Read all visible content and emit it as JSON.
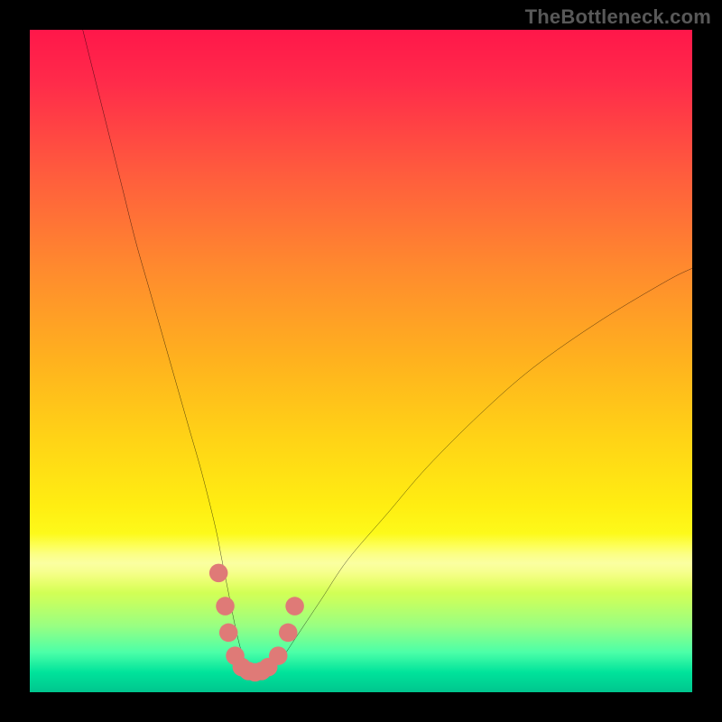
{
  "watermark": {
    "text": "TheBottleneck.com"
  },
  "chart_data": {
    "type": "line",
    "title": "",
    "xlabel": "",
    "ylabel": "",
    "xlim": [
      0,
      100
    ],
    "ylim": [
      0,
      100
    ],
    "grid": false,
    "legend": false,
    "series": [
      {
        "name": "bottleneck-curve",
        "color": "#000000",
        "x": [
          8,
          10,
          12,
          14,
          16,
          18,
          20,
          22,
          24,
          26,
          28,
          29,
          30,
          31,
          32,
          33,
          34,
          35,
          36,
          37,
          38,
          40,
          44,
          48,
          54,
          60,
          68,
          76,
          86,
          96,
          100
        ],
        "y": [
          100,
          92,
          84,
          76,
          68,
          61,
          54,
          47,
          40,
          33,
          25,
          20,
          15,
          10,
          6,
          4,
          3,
          3,
          3,
          4,
          5,
          8,
          14,
          20,
          27,
          34,
          42,
          49,
          56,
          62,
          64
        ]
      }
    ],
    "markers": {
      "name": "highlight-dots",
      "color": "#df7a77",
      "points": [
        {
          "x": 28.5,
          "y": 18
        },
        {
          "x": 29.5,
          "y": 13
        },
        {
          "x": 30.0,
          "y": 9
        },
        {
          "x": 31.0,
          "y": 5.5
        },
        {
          "x": 32.0,
          "y": 3.8
        },
        {
          "x": 33.0,
          "y": 3.2
        },
        {
          "x": 34.0,
          "y": 3.0
        },
        {
          "x": 35.0,
          "y": 3.2
        },
        {
          "x": 36.0,
          "y": 3.8
        },
        {
          "x": 37.5,
          "y": 5.5
        },
        {
          "x": 39.0,
          "y": 9
        },
        {
          "x": 40.0,
          "y": 13
        }
      ]
    },
    "background_gradient": {
      "top": "#ff174a",
      "mid": "#ffee12",
      "bottom": "#00c68e"
    }
  }
}
